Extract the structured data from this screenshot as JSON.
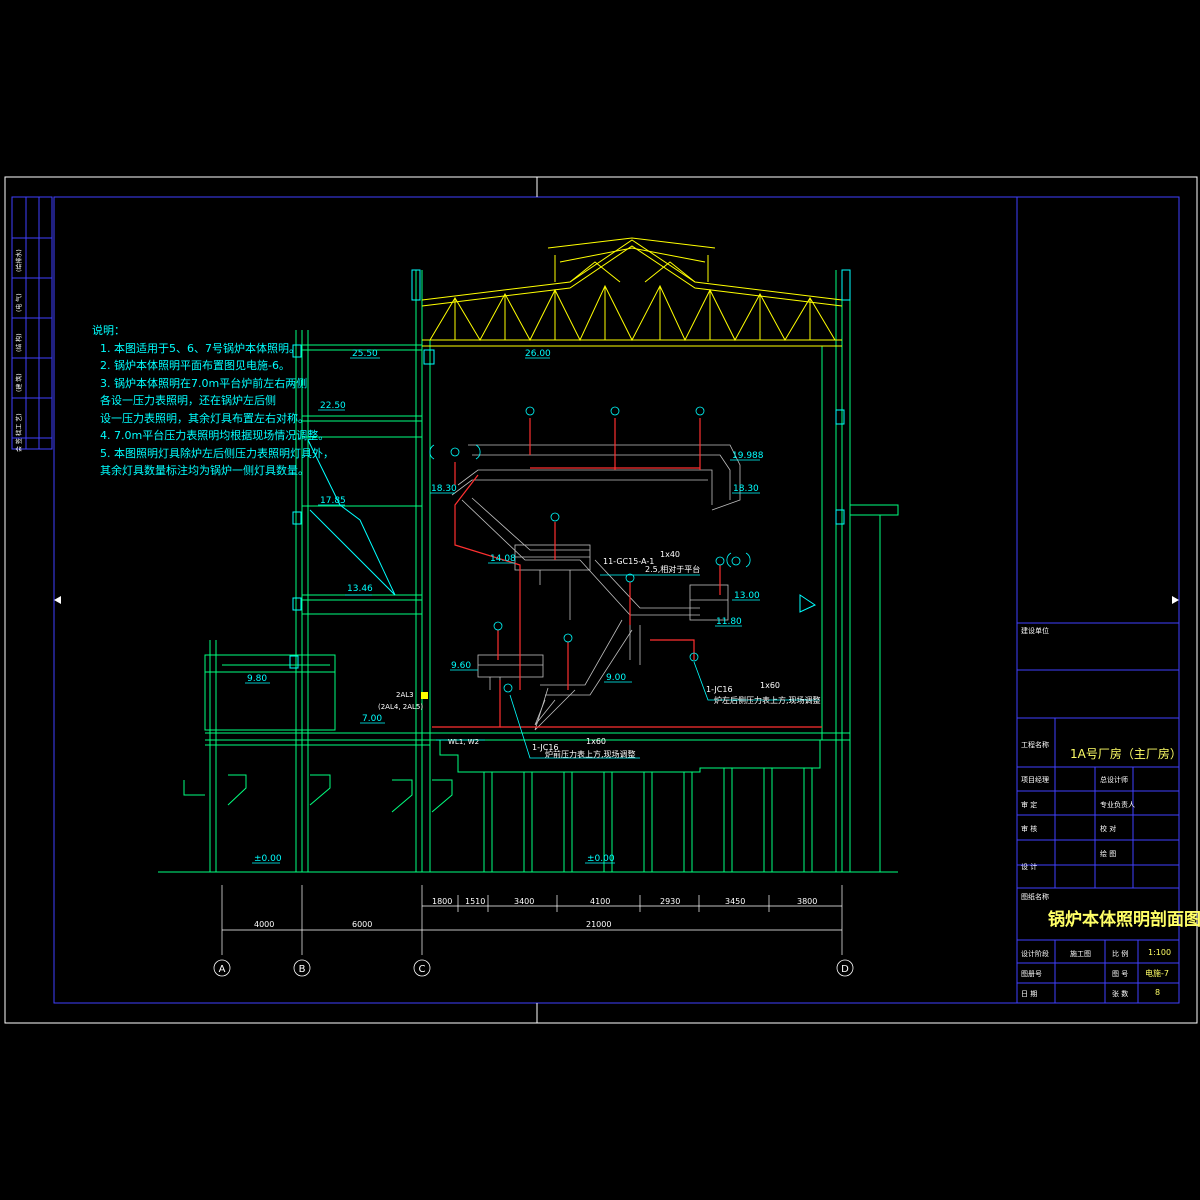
{
  "drawing": {
    "title": "锅炉本体照明剖面图",
    "project_name": "1A号厂房（主厂房）",
    "build_unit_label": "建设单位",
    "project_label": "工程名称",
    "drawing_name_label": "图纸名称"
  },
  "notes": {
    "heading": "说明：",
    "lines": [
      "1. 本图适用于5、6、7号锅炉本体照明。",
      "2. 锅炉本体照明平面布置图见电施-6。",
      "3. 锅炉本体照明在7.0m平台炉前左右两侧",
      "   各设一压力表照明，还在锅炉左后侧",
      "   设一压力表照明，其余灯具布置左右对称。",
      "4. 7.0m平台压力表照明均根据现场情况调整。",
      "5. 本图照明灯具除炉左后侧压力表照明灯具外，",
      "   其余灯具数量标注均为锅炉一侧灯具数量。"
    ]
  },
  "elevations": {
    "e1": "25.50",
    "e2": "26.00",
    "e3": "22.50",
    "e4": "19.988",
    "e5": "18.30",
    "e6": "18.30",
    "e7": "17.85",
    "e8": "14.08",
    "e9": "13.46",
    "e10": "13.00",
    "e11": "11.80",
    "e12": "9.60",
    "e13": "9.00",
    "e14": "9.80",
    "e15": "7.00",
    "e16": "±0.00",
    "e17": "±0.00"
  },
  "annotations": {
    "a1": "11-GC15-A-1",
    "a2": "1x40",
    "a3": "2.5,相对于平台",
    "a4": "1-JC16",
    "a5": "1x60",
    "a6": "炉左后侧压力表上方,现场调整",
    "a7": "1-JC16",
    "a8": "1x60",
    "a9": "炉前压力表上方,现场调整",
    "a10": "2AL3",
    "a11": "(2AL4, 2AL5)",
    "a12": "WL1, W2"
  },
  "dimensions": {
    "top": [
      "1800",
      "1510",
      "3400",
      "4100",
      "2930",
      "3450",
      "3800"
    ],
    "bottom": [
      "4000",
      "6000",
      "21000"
    ]
  },
  "axes": [
    "A",
    "B",
    "C",
    "D"
  ],
  "title_block": {
    "row1_label": "项目经理",
    "row1_right": "总设计师",
    "row2_label": "审 定",
    "row2_right": "专业负责人",
    "row3_label": "审 核",
    "row3_right": "校 对",
    "row4_label": "设 计",
    "row4_right": "绘 图",
    "stage_label": "设计阶段",
    "stage_value": "施工图",
    "scale_label": "比 例",
    "scale_value": "1:100",
    "archive_label": "图册号",
    "drawing_no_label": "图 号",
    "drawing_no_value": "电施-7",
    "date_label": "日 期",
    "sheets_label": "张 数",
    "sheets_value": "8"
  },
  "left_strip": [
    "(工 艺)",
    "(建 筑)",
    "(结 构)",
    "(电 气)",
    "(给排水)",
    "会 签 栏"
  ],
  "colors": {
    "background": "#000000",
    "frame": "#4040ff",
    "structure": "#00ff7f",
    "truss": "#ffff00",
    "cyan": "#00ffff",
    "wire": "#ff3030",
    "stair": "#c0c0c0",
    "text_yellow": "#ffff66"
  }
}
